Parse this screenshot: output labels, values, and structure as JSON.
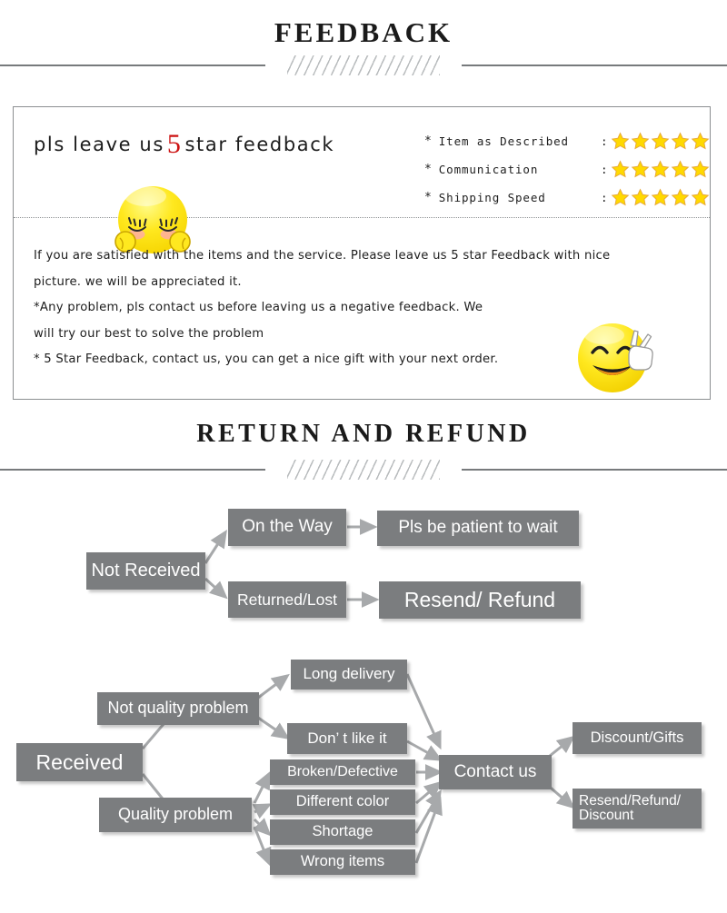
{
  "feedback_section": {
    "title": "FEEDBACK",
    "headline_before": "pls leave us",
    "headline_number": "5",
    "headline_after": "star feedback",
    "ratings": [
      {
        "marker": "*",
        "label": "Item as Described",
        "colon": ":",
        "stars": 5
      },
      {
        "marker": "*",
        "label": "Communication",
        "colon": ":",
        "stars": 5
      },
      {
        "marker": "*",
        "label": "Shipping Speed",
        "colon": ":",
        "stars": 5
      }
    ],
    "body_lines": [
      "If you are satisfied with the items and the service. Please leave us 5 star Feedback with nice",
      "picture. we will be appreciated it.",
      "*Any problem, pls contact us before leaving us a negative feedback. We",
      "will try our best to solve  the problem",
      "* 5 Star Feedback, contact us, you can get a nice gift with your next order."
    ],
    "emoji_shy": "bashful-face-emoji",
    "emoji_happy": "smiling-face-with-peace-sign-emoji"
  },
  "return_section": {
    "title": "RETURN AND REFUND",
    "not_received": {
      "root": "Not Received",
      "branches": [
        {
          "cause": "On the Way",
          "outcome": "Pls be patient to wait"
        },
        {
          "cause": "Returned/Lost",
          "outcome": "Resend/ Refund"
        }
      ]
    },
    "received": {
      "root": "Received",
      "not_quality_problem": "Not quality problem",
      "not_quality_items": [
        "Long delivery",
        "Don’ t like it"
      ],
      "quality_problem": "Quality problem",
      "quality_items": [
        "Broken/Defective",
        "Different color",
        "Shortage",
        "Wrong items"
      ],
      "contact": "Contact us",
      "outcomes": [
        "Discount/Gifts",
        "Resend/Refund/ Discount"
      ],
      "outcome_2_line1": "Resend/Refund/",
      "outcome_2_line2": "Discount"
    }
  },
  "colors": {
    "node_gray": "#7b7d7f",
    "accent_red": "#cc1111",
    "star_yellow": "#ffd900",
    "star_outline": "#e8a93a",
    "rule_gray": "#777a7c",
    "hatch_gray": "#b9bcbe",
    "panel_border": "#8c8f91",
    "text_dark": "#1d1d1d"
  }
}
